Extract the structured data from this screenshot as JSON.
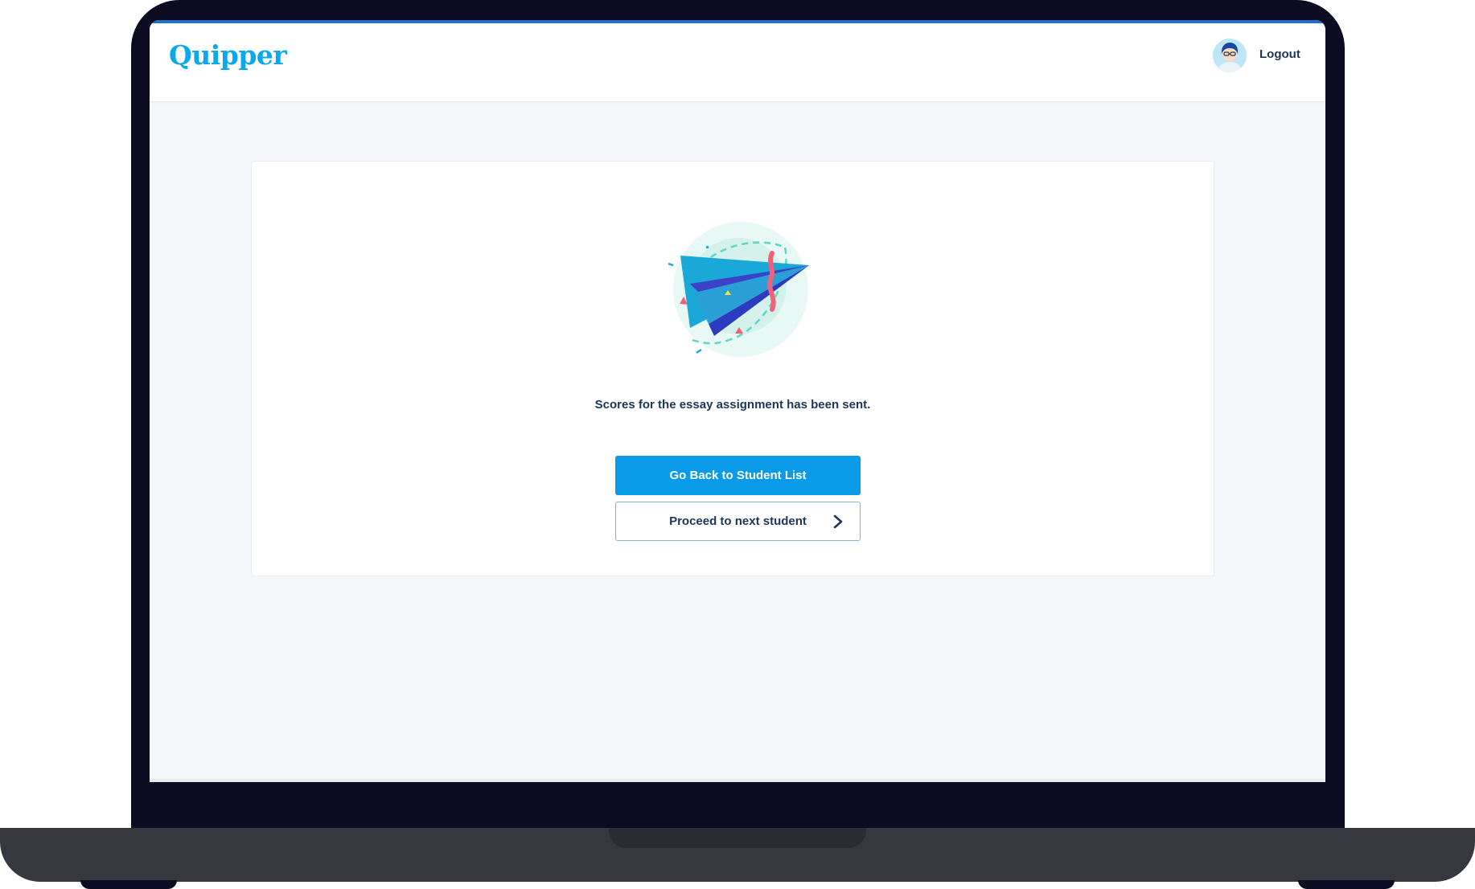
{
  "app": {
    "logo_text": "Quipper"
  },
  "header": {
    "logout_label": "Logout",
    "avatar_icon": "user-avatar-icon"
  },
  "main": {
    "illustration_icon": "paper-plane-icon",
    "message": "Scores for the essay assignment has been sent.",
    "primary_button_label": "Go Back to Student List",
    "secondary_button_label": "Proceed to next student",
    "secondary_button_icon": "chevron-right-icon"
  },
  "colors": {
    "brand": "#0ba8eb",
    "primary_button": "#0a9be8",
    "text_dark": "#1d3557",
    "page_background": "#f5f6f9",
    "device_frame": "#0c0b22"
  }
}
